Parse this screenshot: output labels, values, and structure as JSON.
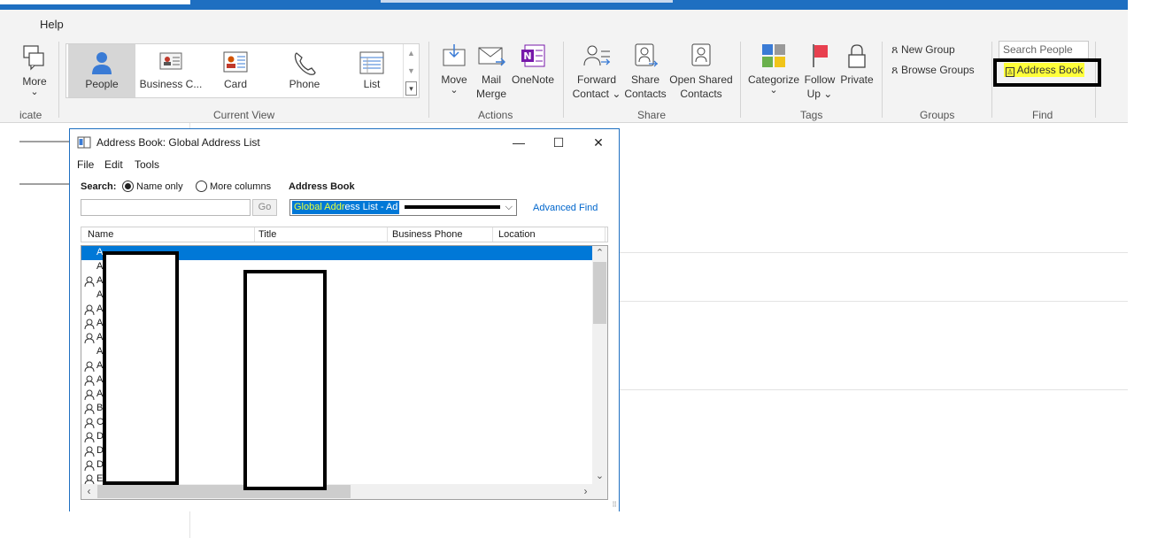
{
  "menu": {
    "help": "Help"
  },
  "ribbon": {
    "more_label": "More",
    "more_arrow": "⌄",
    "communicate_label": "icate",
    "current_view": {
      "group_label": "Current View",
      "items": [
        {
          "label": "People",
          "selected": true
        },
        {
          "label": "Business C...",
          "selected": false
        },
        {
          "label": "Card",
          "selected": false
        },
        {
          "label": "Phone",
          "selected": false
        },
        {
          "label": "List",
          "selected": false
        }
      ]
    },
    "actions": {
      "group_label": "Actions",
      "move": "Move",
      "move_arrow": "⌄",
      "mail_merge_1": "Mail",
      "mail_merge_2": "Merge",
      "onenote": "OneNote"
    },
    "share": {
      "group_label": "Share",
      "forward_1": "Forward",
      "forward_2": "Contact ⌄",
      "share_1": "Share",
      "share_2": "Contacts",
      "open_1": "Open Shared",
      "open_2": "Contacts"
    },
    "tags": {
      "group_label": "Tags",
      "categorize": "Categorize",
      "categorize_arrow": "⌄",
      "follow_1": "Follow",
      "follow_2": "Up ⌄",
      "private": "Private"
    },
    "groups": {
      "group_label": "Groups",
      "new_group": "New Group",
      "browse_groups": "Browse Groups"
    },
    "find": {
      "group_label": "Find",
      "search_placeholder": "Search People",
      "address_book": "Address Book"
    }
  },
  "dialog": {
    "title": "Address Book: Global Address List",
    "menu": [
      "File",
      "Edit",
      "Tools"
    ],
    "search_label": "Search:",
    "radio_name_only": "Name only",
    "radio_more_columns": "More columns",
    "address_book_label": "Address Book",
    "search_value": "",
    "go": "Go",
    "address_book_value_a": "Global Addr",
    "address_book_value_b": "ess List - Ad",
    "advanced_find": "Advanced Find",
    "columns": [
      "Name",
      "Title",
      "Business Phone",
      "Location"
    ],
    "rows": [
      {
        "initial": "A",
        "person": false,
        "selected": true
      },
      {
        "initial": "A",
        "person": false,
        "selected": false
      },
      {
        "initial": "A",
        "person": true,
        "selected": false
      },
      {
        "initial": "A",
        "person": false,
        "selected": false
      },
      {
        "initial": "A",
        "person": true,
        "selected": false
      },
      {
        "initial": "A",
        "person": true,
        "selected": false
      },
      {
        "initial": "A",
        "person": true,
        "selected": false
      },
      {
        "initial": "A",
        "person": false,
        "selected": false
      },
      {
        "initial": "A",
        "person": true,
        "selected": false
      },
      {
        "initial": "A",
        "person": true,
        "selected": false
      },
      {
        "initial": "A",
        "person": true,
        "selected": false
      },
      {
        "initial": "B",
        "person": true,
        "selected": false
      },
      {
        "initial": "C",
        "person": true,
        "selected": false
      },
      {
        "initial": "D",
        "person": true,
        "selected": false
      },
      {
        "initial": "D",
        "person": true,
        "selected": false
      },
      {
        "initial": "D",
        "person": true,
        "selected": false
      },
      {
        "initial": "E",
        "person": true,
        "selected": false
      }
    ]
  }
}
